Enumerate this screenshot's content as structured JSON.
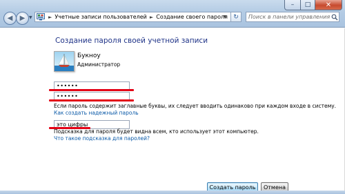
{
  "window": {
    "controls": {
      "minimize": "–",
      "maximize": "□",
      "close": "✕"
    }
  },
  "navigation": {
    "back_glyph": "◀",
    "forward_glyph": "▶",
    "dropdown_glyph": "▼"
  },
  "address_bar": {
    "separator": "►",
    "breadcrumbs": [
      "Учетные записи пользователей",
      "Создание своего пароля"
    ],
    "dropdown_glyph": "▼",
    "refresh_glyph": "↻",
    "icon": "control-panel-icon"
  },
  "search": {
    "placeholder": "Поиск в панели управления",
    "icon": "search-icon"
  },
  "page": {
    "title": "Создание пароля своей учетной записи"
  },
  "user": {
    "name": "Букноу",
    "role": "Администратор",
    "avatar_icon": "sailboat-icon"
  },
  "form": {
    "new_password": "••••••",
    "confirm_password": "••••••",
    "case_note": "Если пароль содержит заглавные буквы, их следует вводить одинаково при каждом входе в систему.",
    "strong_password_link": "Как создать надежный пароль",
    "hint_value": "это цифры",
    "hint_note": "Подсказка для пароля будет видна всем, кто использует этот компьютер.",
    "hint_link": "Что такое подсказка для паролей?"
  },
  "buttons": {
    "create": "Создать пароль",
    "cancel": "Отмена"
  },
  "colors": {
    "title": "#1e3287",
    "link": "#0b5aa8",
    "annotation_red": "#e30015",
    "chrome_blue": "#b3cbe4"
  }
}
